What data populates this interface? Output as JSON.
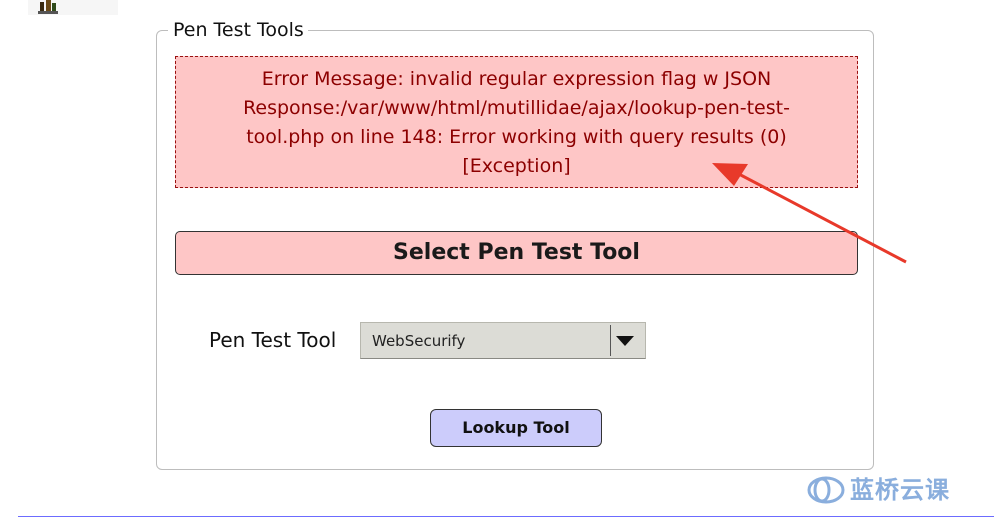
{
  "fieldset": {
    "legend": "Pen Test Tools"
  },
  "error": {
    "message": "Error Message: invalid regular expression flag w JSON Response:/var/www/html/mutillidae/ajax/lookup-pen-test-tool.php on line 148: Error working with query results (0) [Exception]"
  },
  "section": {
    "title": "Select Pen Test Tool"
  },
  "form": {
    "label": "Pen Test Tool",
    "selected": "WebSecurify",
    "button": "Lookup Tool"
  },
  "watermark": {
    "text": "蓝桥云课"
  },
  "colors": {
    "error_bg": "#fec6c6",
    "error_text": "#8c0000",
    "button_bg": "#ccccfb",
    "annotation_arrow": "#e8392a",
    "watermark": "#8aaedd"
  },
  "icons": [
    "logo-icon",
    "dropdown-arrow-icon",
    "annotation-arrow-icon",
    "watermark-logo-icon"
  ]
}
